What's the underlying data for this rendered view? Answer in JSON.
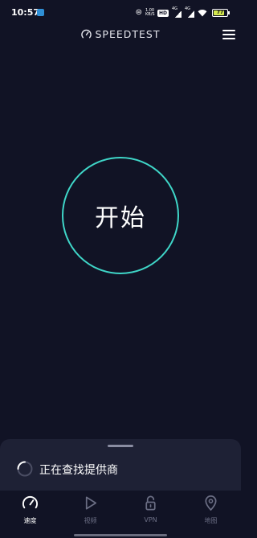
{
  "status_bar": {
    "time": "10:57",
    "net_speed_top": "1.00",
    "net_speed_bottom": "KB/S",
    "hd_label": "HD",
    "signal1_label": "4G",
    "signal2_label": "4G",
    "battery_level": "77"
  },
  "header": {
    "app_title": "SPEEDTEST"
  },
  "main": {
    "go_button_label": "开始"
  },
  "sheet": {
    "status_text": "正在查找提供商"
  },
  "nav": {
    "items": [
      {
        "label": "速度",
        "icon": "speedometer-icon",
        "active": true
      },
      {
        "label": "视频",
        "icon": "play-icon",
        "active": false
      },
      {
        "label": "VPN",
        "icon": "lock-icon",
        "active": false
      },
      {
        "label": "地图",
        "icon": "map-pin-icon",
        "active": false
      }
    ]
  },
  "colors": {
    "background": "#111325",
    "accent_ring": "#3fd6c8",
    "sheet": "#1e2135",
    "nav_inactive": "#6b6e84",
    "battery": "#d4e84e"
  }
}
